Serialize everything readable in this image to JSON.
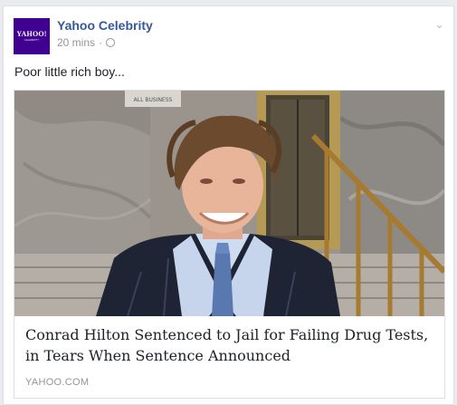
{
  "post": {
    "page_name": "Yahoo Celebrity",
    "timestamp": "20 mins",
    "separator": "·",
    "privacy_icon": "globe-icon",
    "avatar": {
      "brand": "YAHOO!",
      "sub": "CELEBRITY"
    },
    "options_icon": "chevron-down-icon",
    "text": "Poor little rich boy..."
  },
  "link_preview": {
    "image_icon": "article-photo",
    "image_sign_text": "ALL BUSINESS",
    "title": "Conrad Hilton Sentenced to Jail for Failing Drug Tests, in Tears When Sentence Announced",
    "source": "YAHOO.COM"
  }
}
